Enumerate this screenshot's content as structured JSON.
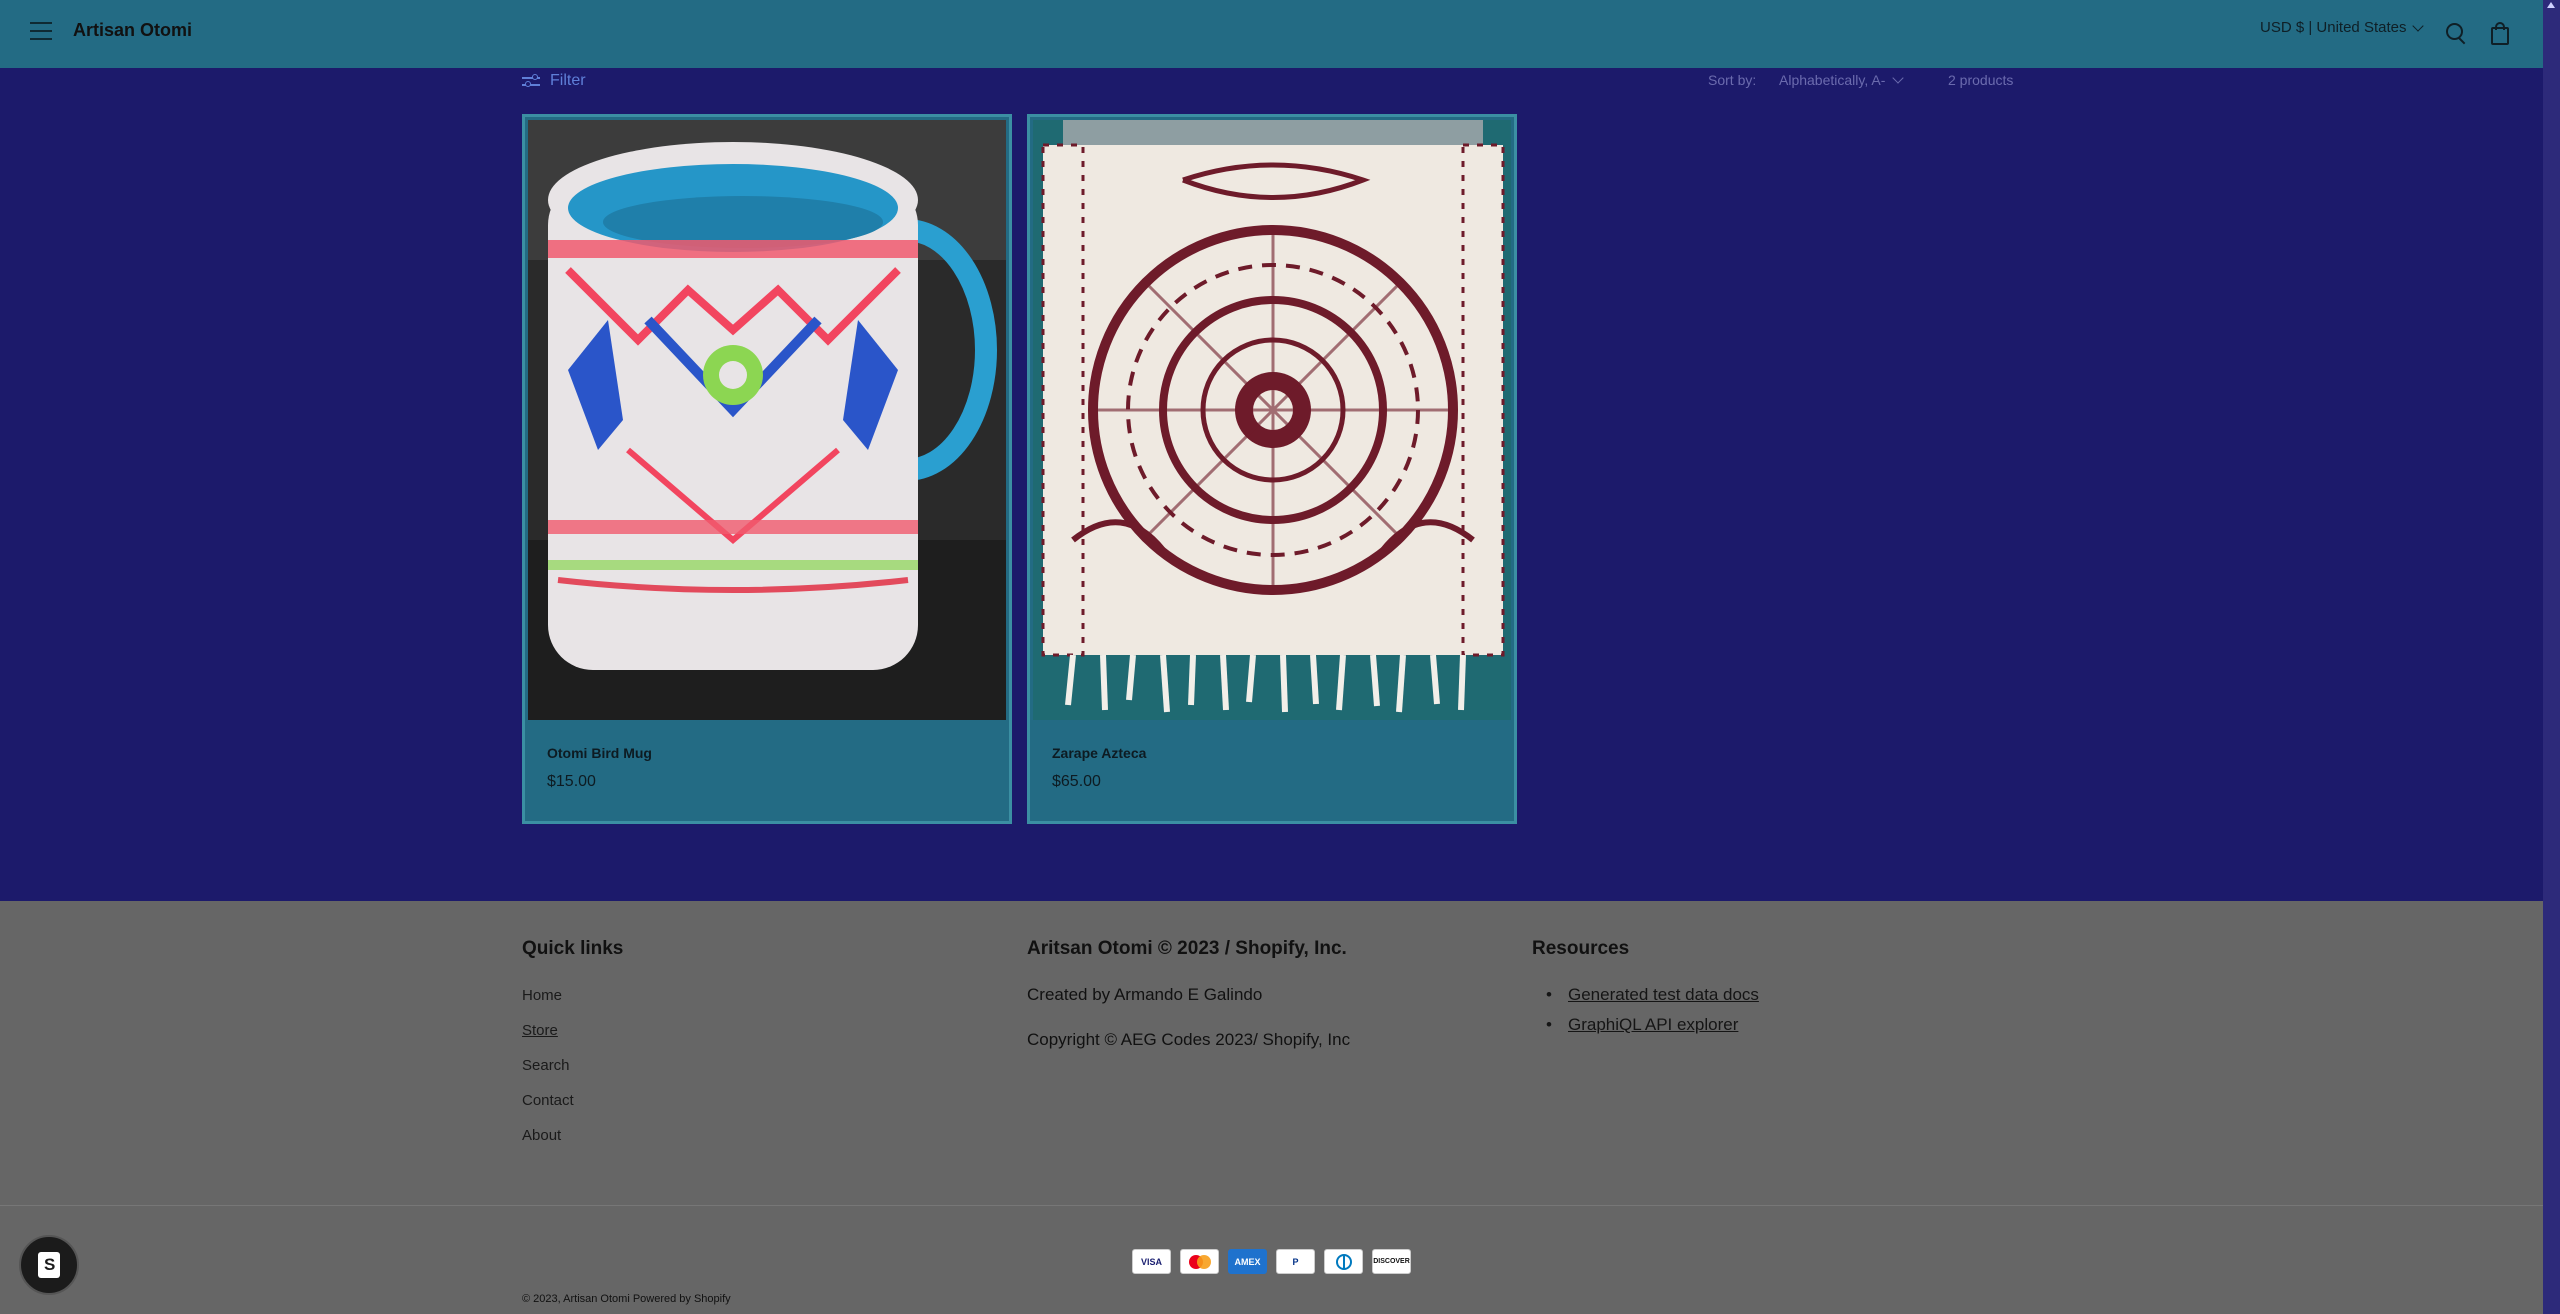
{
  "header": {
    "brand": "Artisan Otomi",
    "currency": "USD $ | United States",
    "icons": [
      "hamburger-icon",
      "search-icon",
      "cart-icon"
    ]
  },
  "toolbar": {
    "filter_label": "Filter",
    "sort_label": "Sort by:",
    "sort_value": "Alphabetically, A-",
    "product_count": "2 products"
  },
  "products": [
    {
      "title": "Otomi Bird Mug",
      "price": "$15.00"
    },
    {
      "title": "Zarape Azteca",
      "price": "$65.00"
    }
  ],
  "footer": {
    "quick_links": {
      "heading": "Quick links",
      "items": [
        "Home",
        "Store",
        "Search",
        "Contact",
        "About"
      ]
    },
    "about": {
      "heading": "Aritsan Otomi © 2023 / Shopify, Inc.",
      "line1": "Created by Armando E Galindo",
      "line2": "Copyright © AEG Codes 2023/ Shopify, Inc"
    },
    "resources": {
      "heading": "Resources",
      "items": [
        "Generated test data docs",
        "GraphiQL API explorer"
      ]
    },
    "payments": [
      "VISA",
      "MC",
      "AMEX",
      "PayPal",
      "Diners",
      "DISCOVER"
    ],
    "copyright": "© 2023, Artisan Otomi Powered by Shopify"
  },
  "colors": {
    "page_bg": "#1c1a6b",
    "header_bg": "#236b84",
    "footer_bg": "#666666",
    "accent_link": "#5f7fd8"
  }
}
